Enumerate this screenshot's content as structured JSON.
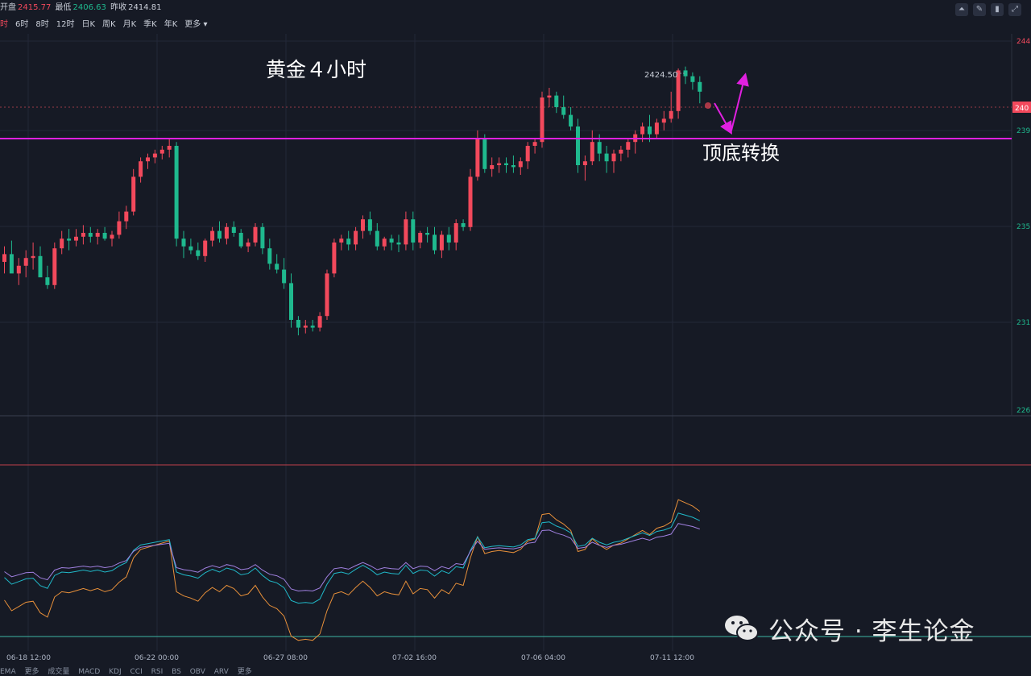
{
  "header": {
    "open_label": "开盘",
    "open": "2415.77",
    "low_label": "最低",
    "low": "2406.63",
    "prev_close_label": "昨收",
    "prev_close": "2414.81"
  },
  "periods": [
    "时",
    "6时",
    "8时",
    "12时",
    "日K",
    "周K",
    "月K",
    "季K",
    "年K",
    "更多"
  ],
  "active_period": "时",
  "toolbar_icons": [
    "chart-line-icon",
    "draw-icon",
    "candle-icon",
    "expand-icon"
  ],
  "annotations": {
    "title": "黄金４小时",
    "level_label": "顶底转换",
    "high_label": "2424.50"
  },
  "colors": {
    "up": "#f2495c",
    "down": "#1fb98e",
    "drawn_line": "#e020e0",
    "background": "#161a25"
  },
  "chart_data": {
    "type": "candlestick",
    "x_ticks": [
      "06-18 12:00",
      "06-22 00:00",
      "06-27 08:00",
      "07-02 16:00",
      "07-06 04:00",
      "07-11 12:00"
    ],
    "y_ticks": [
      "244",
      "240",
      "239",
      "235",
      "231",
      "226"
    ],
    "current_price_tag": "240",
    "highlight_level": 2393
  },
  "watermark": {
    "text": "公众号 · 李生论金"
  },
  "footer": {
    "items": [
      "EMA",
      "更多",
      "成交量",
      "MACD",
      "KDJ",
      "CCI",
      "RSI",
      "BS",
      "OBV",
      "ARV",
      "更多"
    ]
  }
}
